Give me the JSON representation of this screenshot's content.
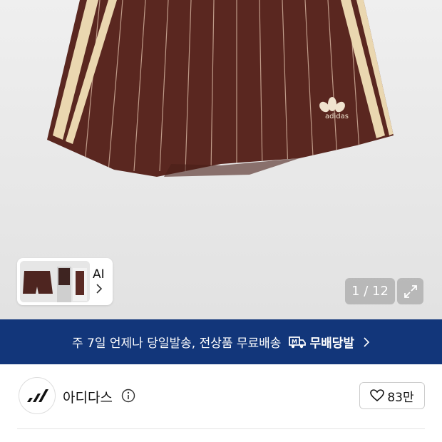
{
  "gallery": {
    "counter": "1 / 12",
    "ai_label": "AI",
    "product_logo_text": "adidas"
  },
  "banner": {
    "text": "주 7일 언제나 당일발송, 전상품 무료배송",
    "badge_label": "무배당발"
  },
  "brand": {
    "name": "아디다스",
    "likes": "83만"
  },
  "colors": {
    "shorts": "#5a2720",
    "stripe": "#ead7b0",
    "banner": "#12367a"
  }
}
